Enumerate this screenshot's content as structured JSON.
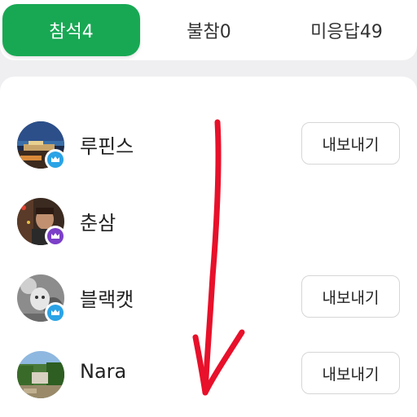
{
  "tabs": [
    {
      "label": "참석4",
      "active": true
    },
    {
      "label": "불참0",
      "active": false
    },
    {
      "label": "미응답49",
      "active": false
    }
  ],
  "members": [
    {
      "name": "루핀스",
      "badge": "blue-crown-icon",
      "badge_color": "#2aa3e6",
      "export_label": "내보내기",
      "has_export": true
    },
    {
      "name": "춘삼",
      "badge": "purple-crown-icon",
      "badge_color": "#7b3fc8",
      "export_label": "",
      "has_export": false
    },
    {
      "name": "블랙캣",
      "badge": "blue-crown-icon",
      "badge_color": "#2aa3e6",
      "export_label": "내보내기",
      "has_export": true
    },
    {
      "name": "Nara",
      "badge": "",
      "export_label": "내보내기",
      "has_export": true
    }
  ],
  "colors": {
    "accent": "#18a854",
    "annotation_arrow": "#e8102a"
  }
}
